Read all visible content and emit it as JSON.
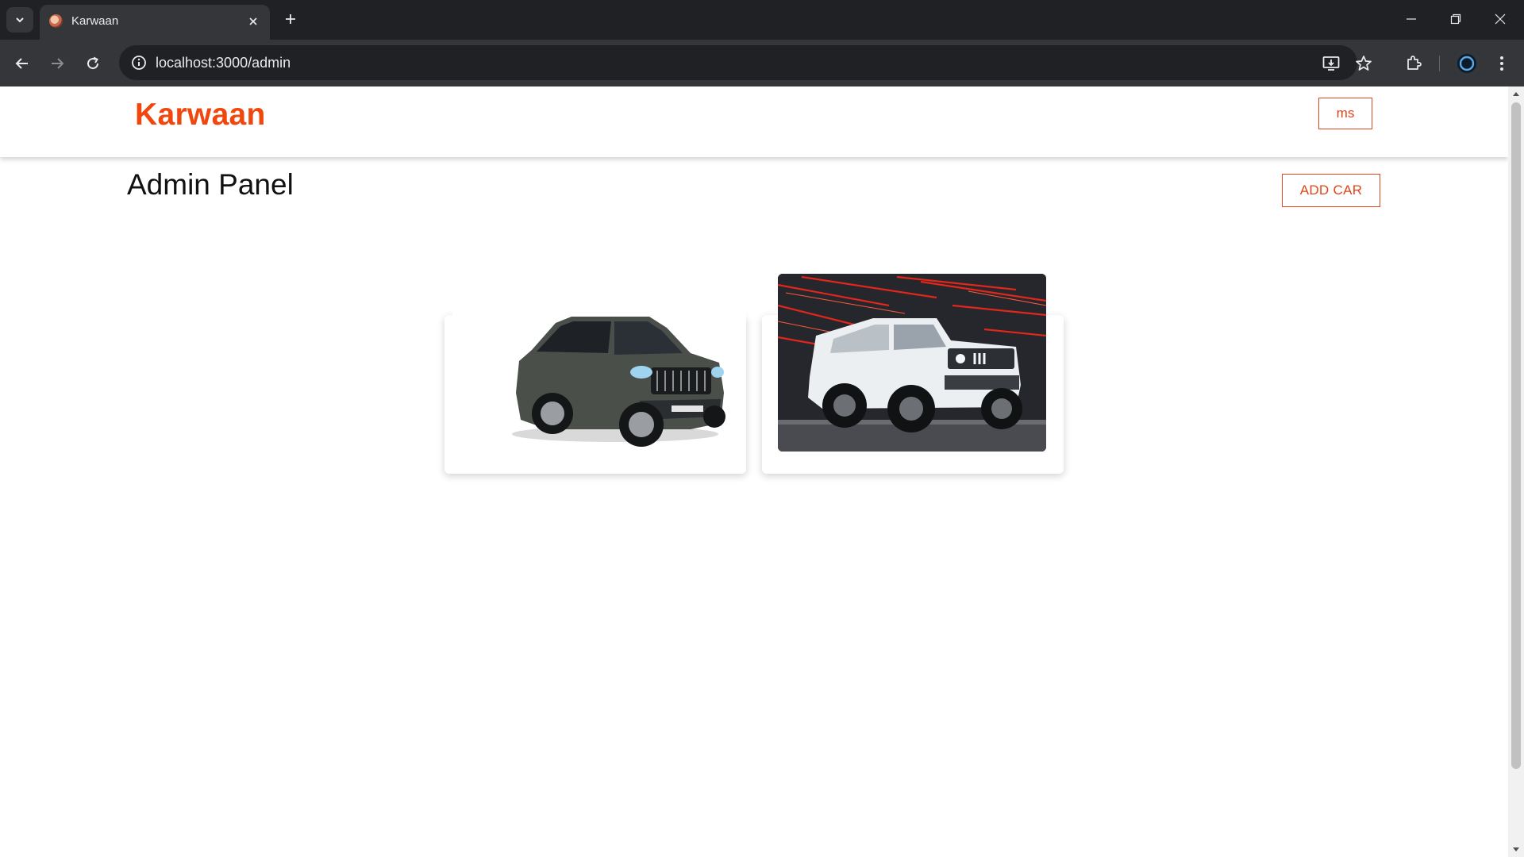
{
  "browser": {
    "tab_title": "Karwaan",
    "url": "localhost:3000/admin"
  },
  "site": {
    "brand": "Karwaan",
    "user_button": "ms",
    "page_title": "Admin Panel",
    "add_car_label": "ADD CAR",
    "accent_color": "#f0470f"
  },
  "cars": [
    {
      "image": "dark-grey-suv-photo"
    },
    {
      "image": "white-offroad-suv-photo"
    }
  ]
}
